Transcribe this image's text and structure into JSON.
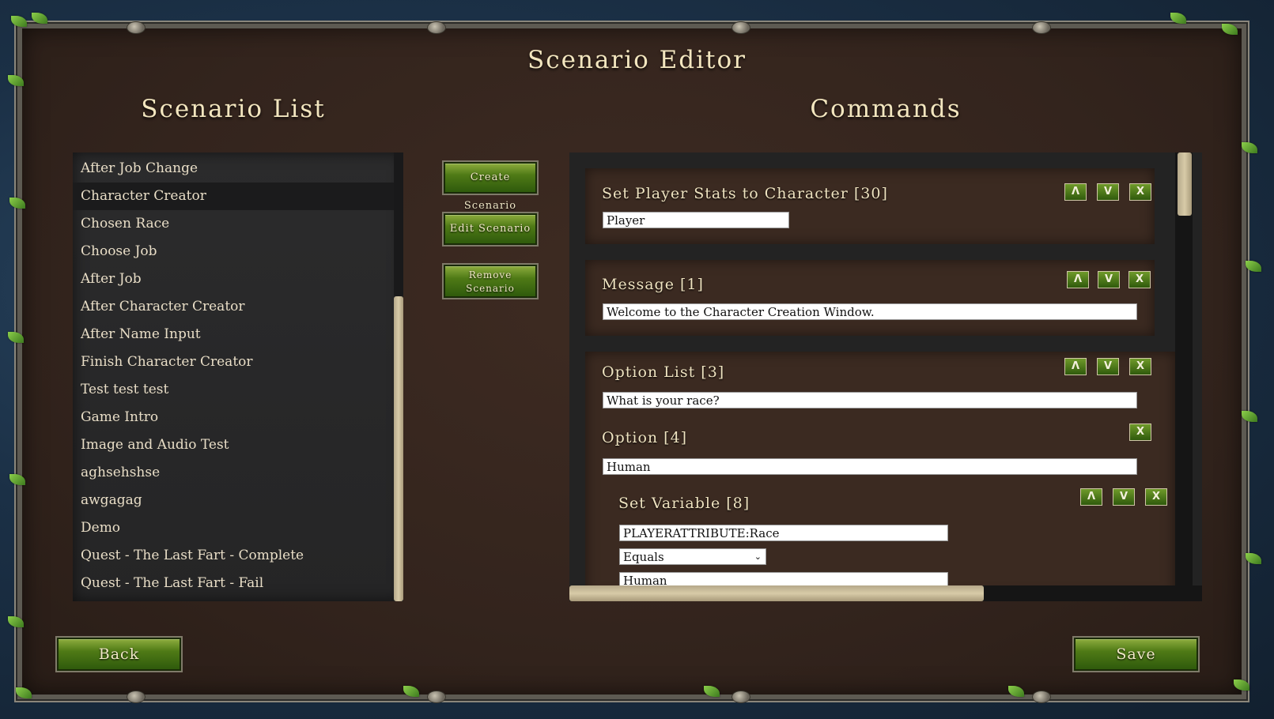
{
  "window": {
    "title": "Scenario Editor"
  },
  "scenario_list": {
    "heading": "Scenario List",
    "selected_index": 1,
    "items": [
      "After Job Change",
      "Character Creator",
      "Chosen Race",
      "Choose Job",
      "After Job",
      "After Character Creator",
      "After Name Input",
      "Finish Character Creator",
      "Test test test",
      "Game Intro",
      "Image and Audio Test",
      "aghsehshse",
      "awgagag",
      "Demo",
      "Quest - The Last Fart - Complete",
      "Quest - The Last Fart - Fail"
    ]
  },
  "actions": {
    "create": "Create Scenario",
    "edit": "Edit Scenario",
    "remove_line1": "Remove",
    "remove_line2": "Scenario"
  },
  "commands": {
    "heading": "Commands",
    "move_up": "Λ",
    "move_down": "V",
    "delete": "X",
    "set_player_stats": {
      "title": "Set Player Stats to Character  [30]",
      "value": "Player"
    },
    "message": {
      "title": "Message  [1]",
      "value": "Welcome to the Character Creation Window."
    },
    "option_list": {
      "title": "Option List [3]",
      "value": "What is your race?"
    },
    "option": {
      "title": "Option [4]",
      "value": "Human"
    },
    "set_variable": {
      "title": "Set Variable [8]",
      "variable": "PLAYERATTRIBUTE:Race",
      "operator": "Equals",
      "value": "Human"
    }
  },
  "footer": {
    "back": "Back",
    "save": "Save"
  }
}
